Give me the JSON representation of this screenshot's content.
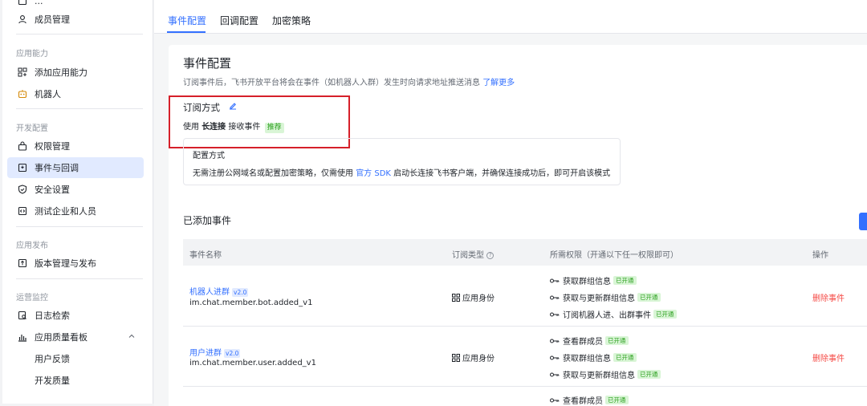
{
  "sidebar": {
    "top_partial": "...",
    "member_mgmt": "成员管理",
    "group_app_ability": "应用能力",
    "add_ability": "添加应用能力",
    "bot": "机器人",
    "group_dev_config": "开发配置",
    "permission_mgmt": "权限管理",
    "events_callbacks": "事件与回调",
    "security": "安全设置",
    "test_enterprise": "测试企业和人员",
    "group_app_publish": "应用发布",
    "version_mgmt": "版本管理与发布",
    "group_ops": "运营监控",
    "log_search": "日志检索",
    "quality_board": "应用质量看板",
    "user_feedback": "用户反馈",
    "dev_quality": "开发质量"
  },
  "tabs": [
    "事件配置",
    "回调配置",
    "加密策略"
  ],
  "section": {
    "title": "事件配置",
    "desc_prefix": "订阅事件后，飞书开放平台将会在事件（如机器人入群）发生时向请求地址推送消息",
    "learn_more": "了解更多",
    "sub_mode_title": "订阅方式",
    "use_prefix": "使用",
    "use_bold": "长连接",
    "use_suffix": "接收事件",
    "recommend_tag": "推荐",
    "config_title": "配置方式",
    "config_desc_prefix": "无需注册公网域名或配置加密策略，仅需使用",
    "config_link": "官方 SDK",
    "config_desc_suffix": "启动长连接飞书客户端，并确保连接成功后，即可开启该模式"
  },
  "events_section": {
    "title": "已添加事件",
    "headers": {
      "name": "事件名称",
      "type": "订阅类型",
      "perms": "所需权限（开通以下任一权限即可）",
      "actions": "操作"
    },
    "rows": [
      {
        "name": "机器人进群",
        "version": "v2.0",
        "code": "im.chat.member.bot.added_v1",
        "type": "应用身份",
        "perms": [
          {
            "name": "获取群组信息",
            "status": "已开通"
          },
          {
            "name": "获取与更新群组信息",
            "status": "已开通"
          },
          {
            "name": "订阅机器人进、出群事件",
            "status": "已开通"
          }
        ],
        "action": "删除事件"
      },
      {
        "name": "用户进群",
        "version": "v2.0",
        "code": "im.chat.member.user.added_v1",
        "type": "应用身份",
        "perms": [
          {
            "name": "查看群成员",
            "status": "已开通"
          },
          {
            "name": "获取群组信息",
            "status": "已开通"
          },
          {
            "name": "获取与更新群组信息",
            "status": "已开通"
          }
        ],
        "action": "删除事件"
      },
      {
        "perms": [
          {
            "name": "查看群成员",
            "status": "已开通"
          }
        ]
      }
    ]
  },
  "colors": {
    "accent": "#3370ff",
    "danger": "#f54a45",
    "success": "#2ea121",
    "highlight_border": "#d6202a"
  }
}
